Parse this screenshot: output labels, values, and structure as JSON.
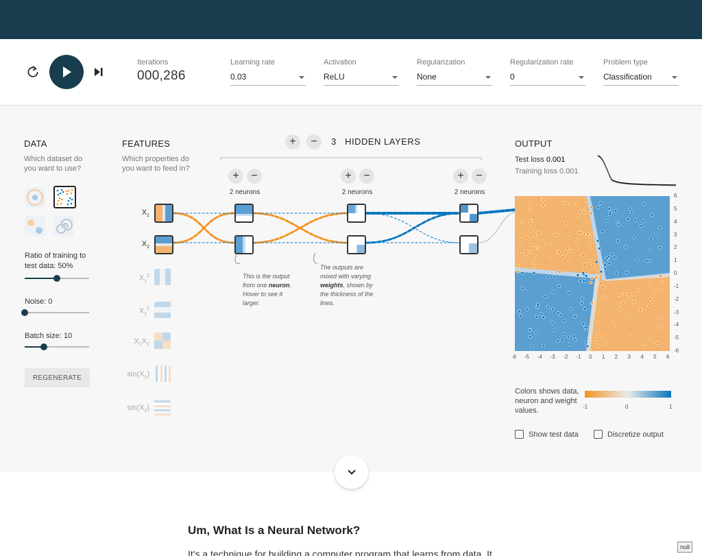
{
  "controls": {
    "iterations": {
      "label": "Iterations",
      "value": "000,286"
    },
    "learning_rate": {
      "label": "Learning rate",
      "value": "0.03"
    },
    "activation": {
      "label": "Activation",
      "value": "ReLU"
    },
    "regularization": {
      "label": "Regularization",
      "value": "None"
    },
    "regularization_rate": {
      "label": "Regularization rate",
      "value": "0"
    },
    "problem_type": {
      "label": "Problem type",
      "value": "Classification"
    }
  },
  "data": {
    "title": "DATA",
    "subtitle": "Which dataset do you want to use?",
    "ratio_label": "Ratio of training to test data:",
    "ratio_value": "50%",
    "ratio_fraction": 0.5,
    "noise_label": "Noise:",
    "noise_value": "0",
    "noise_fraction": 0.0,
    "batch_label": "Batch size:",
    "batch_value": "10",
    "batch_fraction": 0.3,
    "regenerate": "REGENERATE"
  },
  "features": {
    "title": "FEATURES",
    "subtitle": "Which properties do you want to feed in?",
    "items": [
      {
        "label": "X",
        "sub": "1",
        "sup": ""
      },
      {
        "label": "X",
        "sub": "2",
        "sup": ""
      },
      {
        "label": "X",
        "sub": "1",
        "sup": "2"
      },
      {
        "label": "X",
        "sub": "2",
        "sup": "2"
      },
      {
        "label": "X",
        "sub": "1",
        "label2": "X",
        "sub2": "2"
      },
      {
        "label": "sin(X",
        "sub": "1",
        "end": ")"
      },
      {
        "label": "sin(X",
        "sub": "2",
        "end": ")"
      }
    ]
  },
  "network": {
    "hidden_count": "3",
    "hidden_label": "HIDDEN LAYERS",
    "layers": [
      {
        "neurons_label": "2 neurons"
      },
      {
        "neurons_label": "2 neurons"
      },
      {
        "neurons_label": "2 neurons"
      }
    ],
    "annotation1": {
      "pre": "This is the output from one ",
      "bold": "neuron",
      "post": ". Hover to see it larger."
    },
    "annotation2": {
      "pre": "The outputs are mixed with varying ",
      "bold": "weights",
      "post": ", shown by the thickness of the lines."
    }
  },
  "output": {
    "title": "OUTPUT",
    "test_loss_label": "Test loss",
    "test_loss_value": "0.001",
    "training_loss_label": "Training loss",
    "training_loss_value": "0.001",
    "legend_text": "Colors shows data, neuron and weight values.",
    "legend_ticks": [
      "-1",
      "0",
      "1"
    ],
    "show_test_data": "Show test data",
    "discretize_output": "Discretize output",
    "axis_ticks": [
      "-6",
      "-5",
      "-4",
      "-3",
      "-2",
      "-1",
      "0",
      "1",
      "2",
      "3",
      "4",
      "5",
      "6"
    ]
  },
  "colors": {
    "orange": "#f59322",
    "blue": "#0877bd",
    "dark": "#183d4e"
  },
  "article": {
    "title": "Um, What Is a Neural Network?",
    "first_line": "It's a technique for building a computer program that learns from data. It"
  },
  "badge": "null"
}
